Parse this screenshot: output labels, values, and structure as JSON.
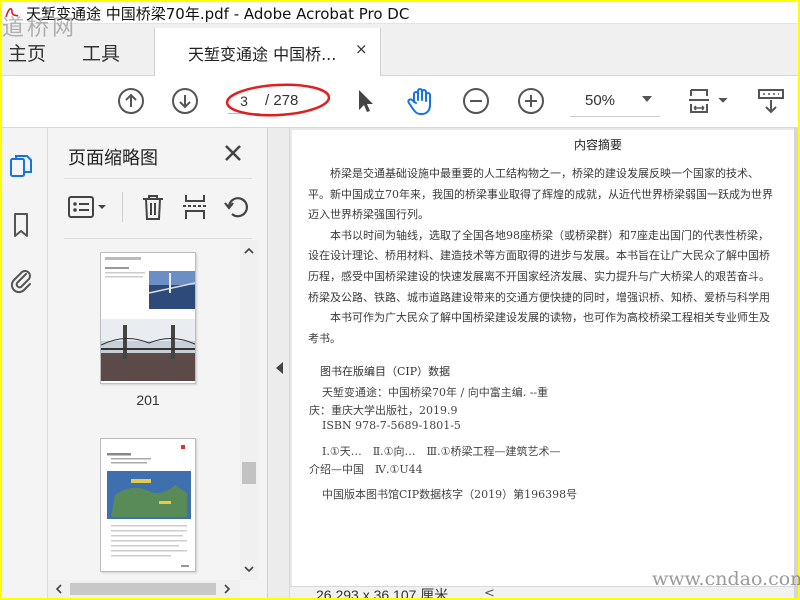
{
  "window": {
    "title": "天堑变通途 中国桥梁70年.pdf - Adobe Acrobat Pro DC",
    "watermark_top": "道桥网",
    "watermark_bottom": "www.cndao.com"
  },
  "tabs": {
    "home": "主页",
    "tools": "工具",
    "document": "天堑变通途 中国桥...",
    "close": "×"
  },
  "toolbar": {
    "page_current": "3",
    "page_total": "/ 278",
    "zoom": "50%",
    "highlight_color": "#e02020",
    "accent_color": "#1473e6"
  },
  "nav_rail": {
    "icons": [
      "page-thumbnails-icon",
      "bookmark-icon",
      "attachment-icon"
    ]
  },
  "thumbnails_panel": {
    "title": "页面缩略图",
    "close": "×",
    "pages": [
      {
        "label": "201"
      },
      {
        "label": ""
      }
    ]
  },
  "document": {
    "heading": "内容摘要",
    "paragraphs": [
      "　　桥梁是交通基础设施中最重要的人工结构物之一，桥梁的建设发展反映一个国家的技术、",
      "平。新中国成立70年来，我国的桥梁事业取得了辉煌的成就，从近代世界桥梁弱国一跃成为世界",
      "迈入世界桥梁强国行列。",
      "　　本书以时间为轴线，选取了全国各地98座桥梁（或桥梁群）和7座走出国门的代表性桥梁，",
      "设在设计理论、桥用材料、建造技术等方面取得的进步与发展。本书旨在让广大民众了解中国桥",
      "历程，感受中国桥梁建设的快速发展离不开国家经济发展、实力提升与广大桥梁人的艰苦奋斗。",
      "桥梁及公路、铁路、城市道路建设带来的交通方便快捷的同时，增强识桥、知桥、爱桥与科学用",
      "　　本书可作为广大民众了解中国桥梁建设发展的读物，也可作为高校桥梁工程相关专业师生及",
      "考书。"
    ],
    "cip_title": "图书在版编目（CIP）数据",
    "cip_lines": [
      "天堑变通途：中国桥梁70年 / 向中富主编. --重",
      "庆：重庆大学出版社，2019.9",
      "ISBN  978-7-5689-1801-5",
      "Ⅰ.①天…　Ⅱ.①向…　Ⅲ.①桥梁工程—建筑艺术—",
      "介绍—中国　Ⅳ.①U44",
      "中国版本图书馆CIP数据核字（2019）第196398号"
    ]
  },
  "status": {
    "dimensions": "26.293 x 36.107 厘米"
  }
}
